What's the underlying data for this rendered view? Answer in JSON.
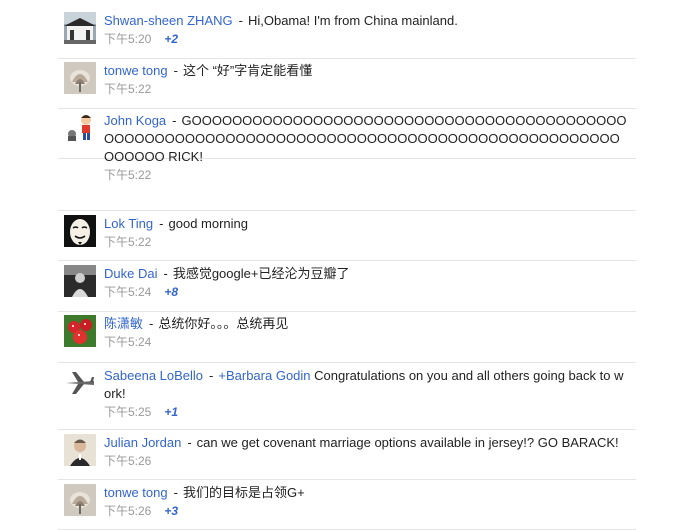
{
  "comments": [
    {
      "author": "Shwan-sheen ZHANG",
      "text": "Hi,Obama! I'm from China mainland.",
      "time": "下午5:20",
      "plus": "+2",
      "avatar_icon": "building-photo-icon"
    },
    {
      "author": "tonwe tong",
      "text": "这个 “好”字肯定能看懂",
      "time": "下午5:22",
      "plus": "",
      "avatar_icon": "flower-photo-icon"
    },
    {
      "author": "John Koga",
      "text": "GOOOOOOOOOOOOOOOOOOOOOOOOOOOOOOOOOOOOOOOOOOOOOOOOOOOOOOOOOOOOOOOOOOOOOOOOOOOOOOOOOOOOOOOOOOOOOOOOOOOO RICK!",
      "time": "下午5:22",
      "plus": "",
      "avatar_icon": "cartoon-kids-icon"
    },
    {
      "author": "Lok Ting",
      "text": "good morning",
      "time": "下午5:22",
      "plus": "",
      "avatar_icon": "mask-photo-icon"
    },
    {
      "author": "Duke Dai",
      "text": "我感觉google+已经沦为豆瓣了",
      "time": "下午5:24",
      "plus": "+8",
      "avatar_icon": "bw-portrait-icon"
    },
    {
      "author": "陈潇敏",
      "text": "总统你好。。。总统再见",
      "time": "下午5:24",
      "plus": "",
      "avatar_icon": "strawberry-photo-icon"
    },
    {
      "author": "Sabeena LoBello",
      "mention": "+Barbara Godin",
      "text": "Congratulations on you and all others going back to work!",
      "time": "下午5:25",
      "plus": "+1",
      "avatar_icon": "jet-plane-icon"
    },
    {
      "author": "Julian Jordan",
      "text": "can we get covenant marriage options available in jersey!? GO BARACK!",
      "time": "下午5:26",
      "plus": "",
      "avatar_icon": "man-portrait-icon"
    },
    {
      "author": "tonwe tong",
      "text": "我们的目标是占领G+",
      "time": "下午5:26",
      "plus": "+3",
      "avatar_icon": "flower-photo-icon"
    }
  ]
}
